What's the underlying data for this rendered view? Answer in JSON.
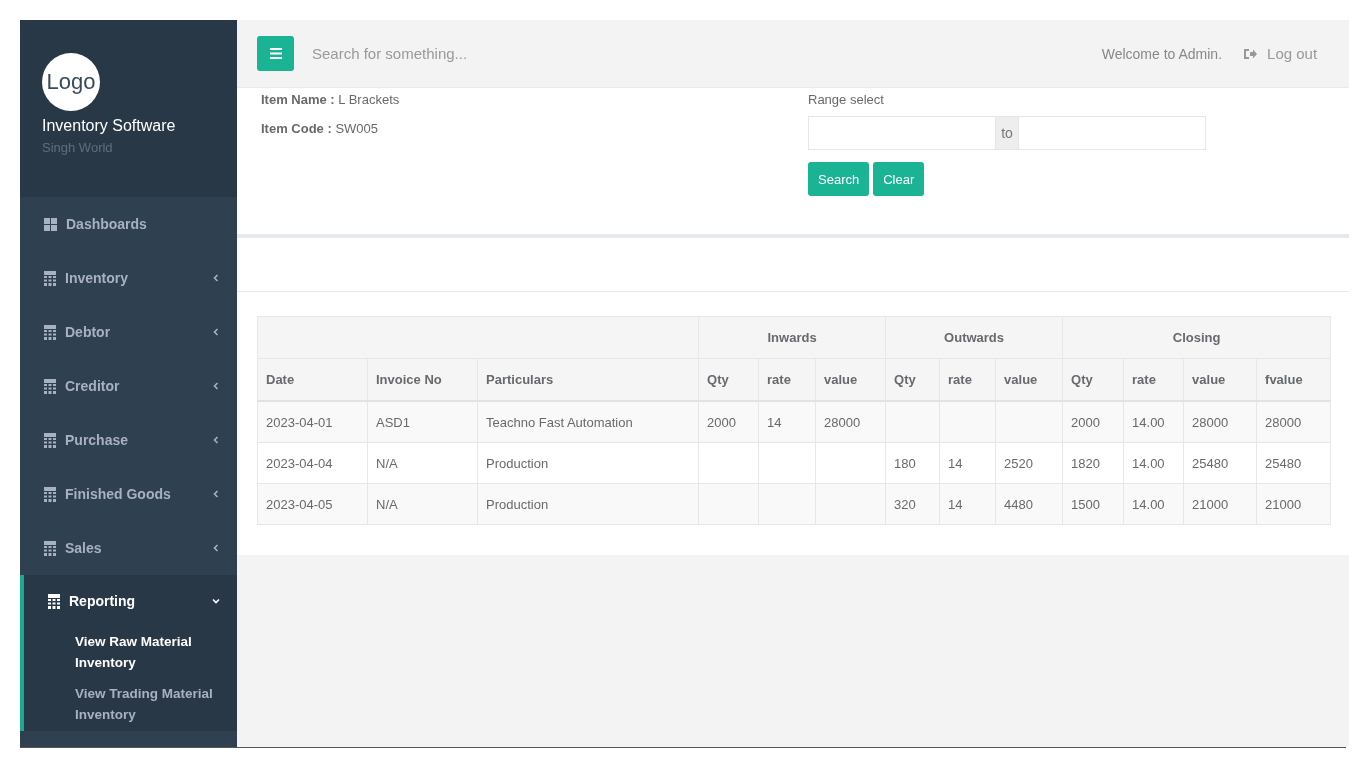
{
  "sidebar": {
    "logo": "Logo",
    "title": "Inventory Software",
    "subtitle": "Singh World",
    "items": [
      {
        "label": "Dashboards",
        "kind": "link",
        "expanded": false,
        "selected": false
      },
      {
        "label": "Inventory",
        "kind": "dropdown",
        "expanded": false,
        "selected": false
      },
      {
        "label": "Debtor",
        "kind": "dropdown",
        "expanded": false,
        "selected": false
      },
      {
        "label": "Creditor",
        "kind": "dropdown",
        "expanded": false,
        "selected": false
      },
      {
        "label": "Purchase",
        "kind": "dropdown",
        "expanded": false,
        "selected": false
      },
      {
        "label": "Finished Goods",
        "kind": "dropdown",
        "expanded": false,
        "selected": false
      },
      {
        "label": "Sales",
        "kind": "dropdown",
        "expanded": false,
        "selected": false
      },
      {
        "label": "Reporting",
        "kind": "dropdown",
        "expanded": true,
        "selected": true,
        "children": [
          {
            "label": "View Raw Material Inventory",
            "selected": true
          },
          {
            "label": "View Trading Material Inventory",
            "selected": false
          }
        ]
      }
    ]
  },
  "topbar": {
    "search": {
      "placeholder": "Search for something..."
    },
    "welcome": "Welcome to Admin.",
    "logout": "Log out"
  },
  "item_info": [
    {
      "label": "Item Name :",
      "value": "L Brackets"
    },
    {
      "label": "Item Code :",
      "value": "SW005"
    }
  ],
  "range": {
    "label": "Range select",
    "separator": "to",
    "buttons": [
      "Search",
      "Clear"
    ]
  },
  "table": {
    "groups": [
      {
        "columns": [
          "Date",
          "Invoice No",
          "Particulars"
        ]
      },
      {
        "label": "Inwards",
        "columns": [
          "Qty",
          "rate",
          "value"
        ]
      },
      {
        "label": "Outwards",
        "columns": [
          "Qty",
          "rate",
          "value"
        ]
      },
      {
        "label": "Closing",
        "columns": [
          "Qty",
          "rate",
          "value",
          "fvalue"
        ]
      }
    ],
    "rows": [
      [
        "2023-04-01",
        "ASD1",
        "Teachno Fast Automation",
        "2000",
        "14",
        "28000",
        null,
        null,
        null,
        "2000",
        "14.00",
        "28000",
        "28000"
      ],
      [
        "2023-04-04",
        "N/A",
        "Production",
        null,
        null,
        null,
        "180",
        "14",
        "2520",
        "1820",
        "14.00",
        "25480",
        "25480"
      ],
      [
        "2023-04-05",
        "N/A",
        "Production",
        null,
        null,
        null,
        "320",
        "14",
        "4480",
        "1500",
        "14.00",
        "21000",
        "21000"
      ]
    ]
  }
}
